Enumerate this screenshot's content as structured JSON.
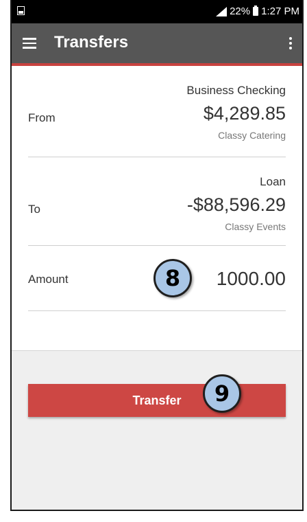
{
  "status_bar": {
    "network": "LTE",
    "battery_percent": "22%",
    "time": "1:27 PM"
  },
  "app_bar": {
    "title": "Transfers",
    "menu_icon": "hamburger-menu-icon",
    "overflow_icon": "more-vert-icon"
  },
  "form": {
    "from": {
      "label": "From",
      "account_name": "Business Checking",
      "balance": "$4,289.85",
      "owner": "Classy Catering"
    },
    "to": {
      "label": "To",
      "account_name": "Loan",
      "balance": "-$88,596.29",
      "owner": "Classy Events"
    },
    "amount": {
      "label": "Amount",
      "value": "1000.00"
    }
  },
  "transfer_button_label": "Transfer",
  "step_badges": {
    "amount_step": "8",
    "transfer_step": "9"
  },
  "colors": {
    "appbar": "#565656",
    "accent": "#c8423f",
    "button": "#cd4744",
    "badge_fill": "#a9c6e6"
  }
}
